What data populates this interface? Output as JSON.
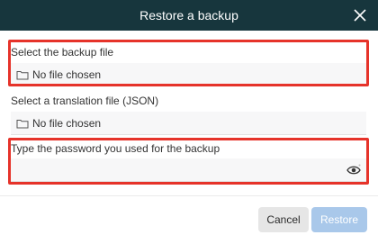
{
  "dialog": {
    "title": "Restore a backup"
  },
  "backup_file": {
    "label": "Select the backup file",
    "value": "No file chosen"
  },
  "translation_file": {
    "label": "Select a translation file (JSON)",
    "value": "No file chosen"
  },
  "password": {
    "label": "Type the password you used for the backup",
    "value": ""
  },
  "buttons": {
    "cancel": "Cancel",
    "restore": "Restore"
  },
  "colors": {
    "titlebar": "#17363d",
    "highlight": "#e6332a",
    "restore_disabled": "#a9c8ea",
    "cancel": "#e6e6e6"
  },
  "icons": {
    "close": "close-icon",
    "folder": "folder-icon",
    "eye": "eye-icon"
  }
}
